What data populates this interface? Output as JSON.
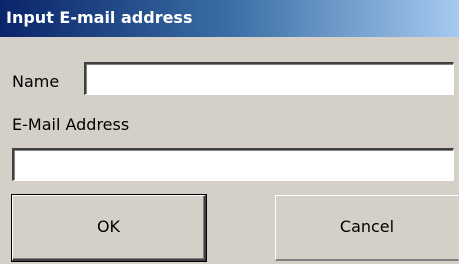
{
  "window": {
    "title": "Input E-mail address"
  },
  "form": {
    "name_label": "Name",
    "name_value": "",
    "email_label": "E-Mail Address",
    "email_value": ""
  },
  "buttons": {
    "ok_label": "OK",
    "cancel_label": "Cancel"
  },
  "colors": {
    "titlebar_start": "#0a246a",
    "titlebar_end": "#a6caf0",
    "dialog_background": "#d4d0c8"
  }
}
